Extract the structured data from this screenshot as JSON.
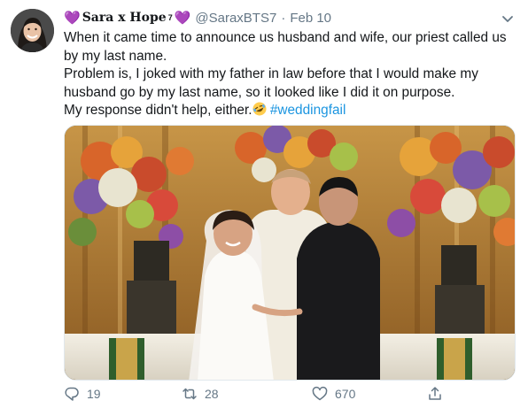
{
  "author": {
    "heart_left": "💜",
    "name": "Sara x Hope",
    "superscript": "7",
    "heart_right": "💜",
    "handle": "@SaraxBTS7",
    "separator": "·",
    "date": "Feb 10"
  },
  "tweet": {
    "line1": "When it came time to announce us husband and wife, our priest called us by my last name.",
    "line2": "Problem is, I joked with my father in law before that I would make my husband go by my last name, so it looked like I did it on purpose.",
    "line3": "My response didn't help, either.",
    "emoji": "rolling-on-floor-laughing",
    "hashtag": "#weddingfail"
  },
  "actions": {
    "replies": "19",
    "retweets": "28",
    "likes": "670"
  },
  "icons": {
    "reply": "reply-icon",
    "retweet": "retweet-icon",
    "like": "heart-icon",
    "share": "share-icon",
    "more": "chevron-down-icon"
  },
  "colors": {
    "hashtag": "#1b95e0",
    "secondary_text": "#657786",
    "heart_emoji": "#a46ad9"
  }
}
